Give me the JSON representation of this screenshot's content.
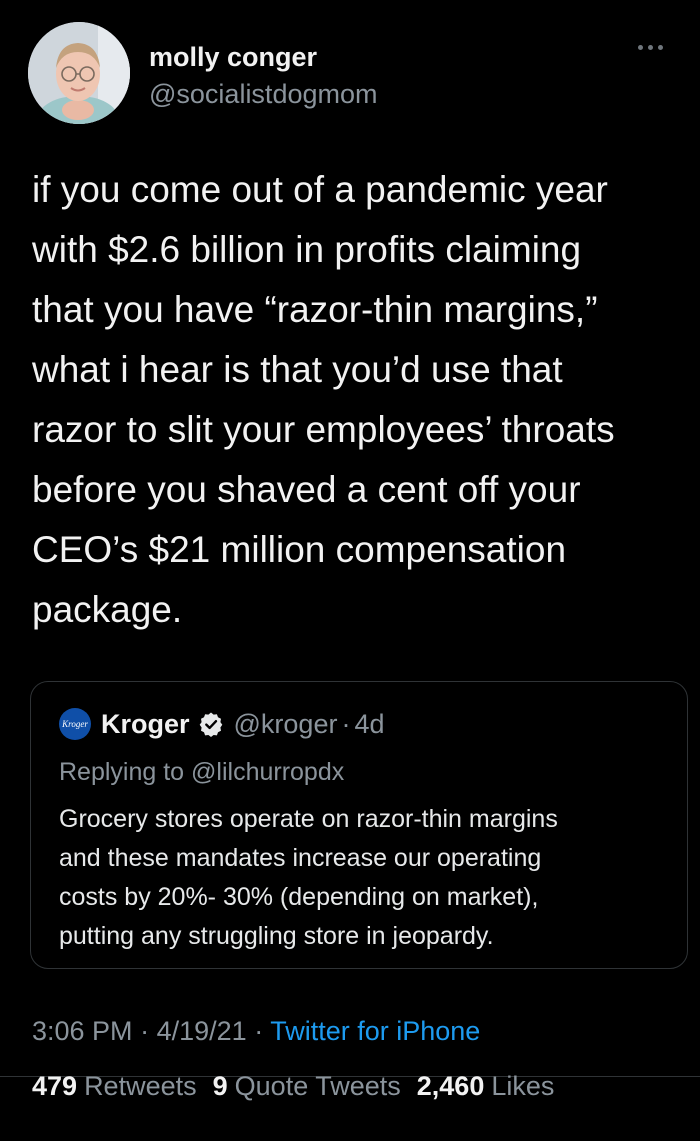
{
  "tweet": {
    "author": {
      "display_name": "molly conger",
      "handle": "@socialistdogmom"
    },
    "body_lines": [
      "if you come out of a pandemic year",
      "with $2.6 billion in profits claiming",
      "that you have “razor-thin margins,”",
      "what i hear is that you’d use that",
      "razor to slit your employees’ throats",
      "before you shaved a cent off your",
      "CEO’s $21 million compensation",
      "package."
    ],
    "quoted": {
      "logo_text": "Kroger",
      "display_name": "Kroger",
      "handle": "@kroger",
      "separator": "·",
      "age": "4d",
      "replying_prefix": "Replying to",
      "replying_to": "@lilchurropdx",
      "text_lines": [
        "Grocery stores operate on razor-thin margins",
        "and these mandates increase our operating",
        "costs by 20%- 30% (depending on market),",
        "putting any struggling store in jeopardy."
      ]
    },
    "time": "3:06 PM",
    "date": "4/19/21",
    "separator": "·",
    "source": "Twitter for iPhone",
    "stats": {
      "retweets_count": "479",
      "retweets_label": "Retweets",
      "quotes_count": "9",
      "quotes_label": "Quote Tweets",
      "likes_count": "2,460",
      "likes_label": "Likes"
    }
  },
  "colors": {
    "background": "#000000",
    "primary_text": "#f2f2f2",
    "secondary_text": "#8b949c",
    "link": "#1d9bf0",
    "border": "#2f3336",
    "kroger_blue": "#0f4fa8"
  }
}
